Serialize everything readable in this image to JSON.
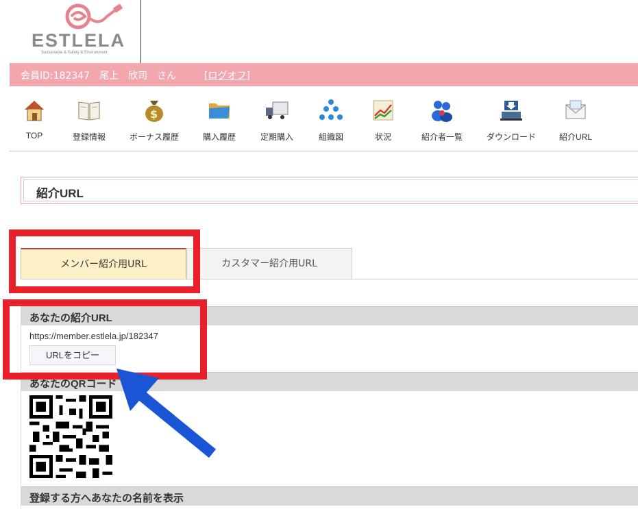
{
  "brand": {
    "name": "ESTLELA",
    "tagline": "Sustainable & Safety & Environment",
    "colors": {
      "logo_pink": "#e8828f",
      "logo_gray": "#8a8a8a"
    }
  },
  "member_bar": {
    "text": "会員ID:182347　尾上　欣司　さん",
    "logout_label": "[ログオフ]",
    "color": "#f2a7ae"
  },
  "nav": [
    {
      "label": "TOP",
      "icon": "house-icon"
    },
    {
      "label": "登録情報",
      "icon": "book-icon"
    },
    {
      "label": "ボーナス履歴",
      "icon": "money-bag-icon"
    },
    {
      "label": "購入履歴",
      "icon": "folder-icon"
    },
    {
      "label": "定期購入",
      "icon": "truck-icon"
    },
    {
      "label": "組織図",
      "icon": "org-chart-icon"
    },
    {
      "label": "状況",
      "icon": "line-graph-icon"
    },
    {
      "label": "紹介者一覧",
      "icon": "users-icon"
    },
    {
      "label": "ダウンロード",
      "icon": "download-laptop-icon"
    },
    {
      "label": "紹介URL",
      "icon": "envelope-icon"
    }
  ],
  "page_title": "紹介URL",
  "tabs": [
    {
      "label": "メンバー紹介用URL",
      "active": true
    },
    {
      "label": "カスタマー紹介用URL",
      "active": false
    }
  ],
  "sections": {
    "referral_url": {
      "heading": "あなたの紹介URL",
      "url": "https://member.estlela.jp/182347",
      "copy_button": "URLをコピー"
    },
    "qr": {
      "heading": "あなたのQRコード"
    },
    "display_name": {
      "heading": "登録する方へあなたの名前を表示"
    }
  },
  "annotation_colors": {
    "red": "#e8202a",
    "blue": "#1a55d6"
  }
}
